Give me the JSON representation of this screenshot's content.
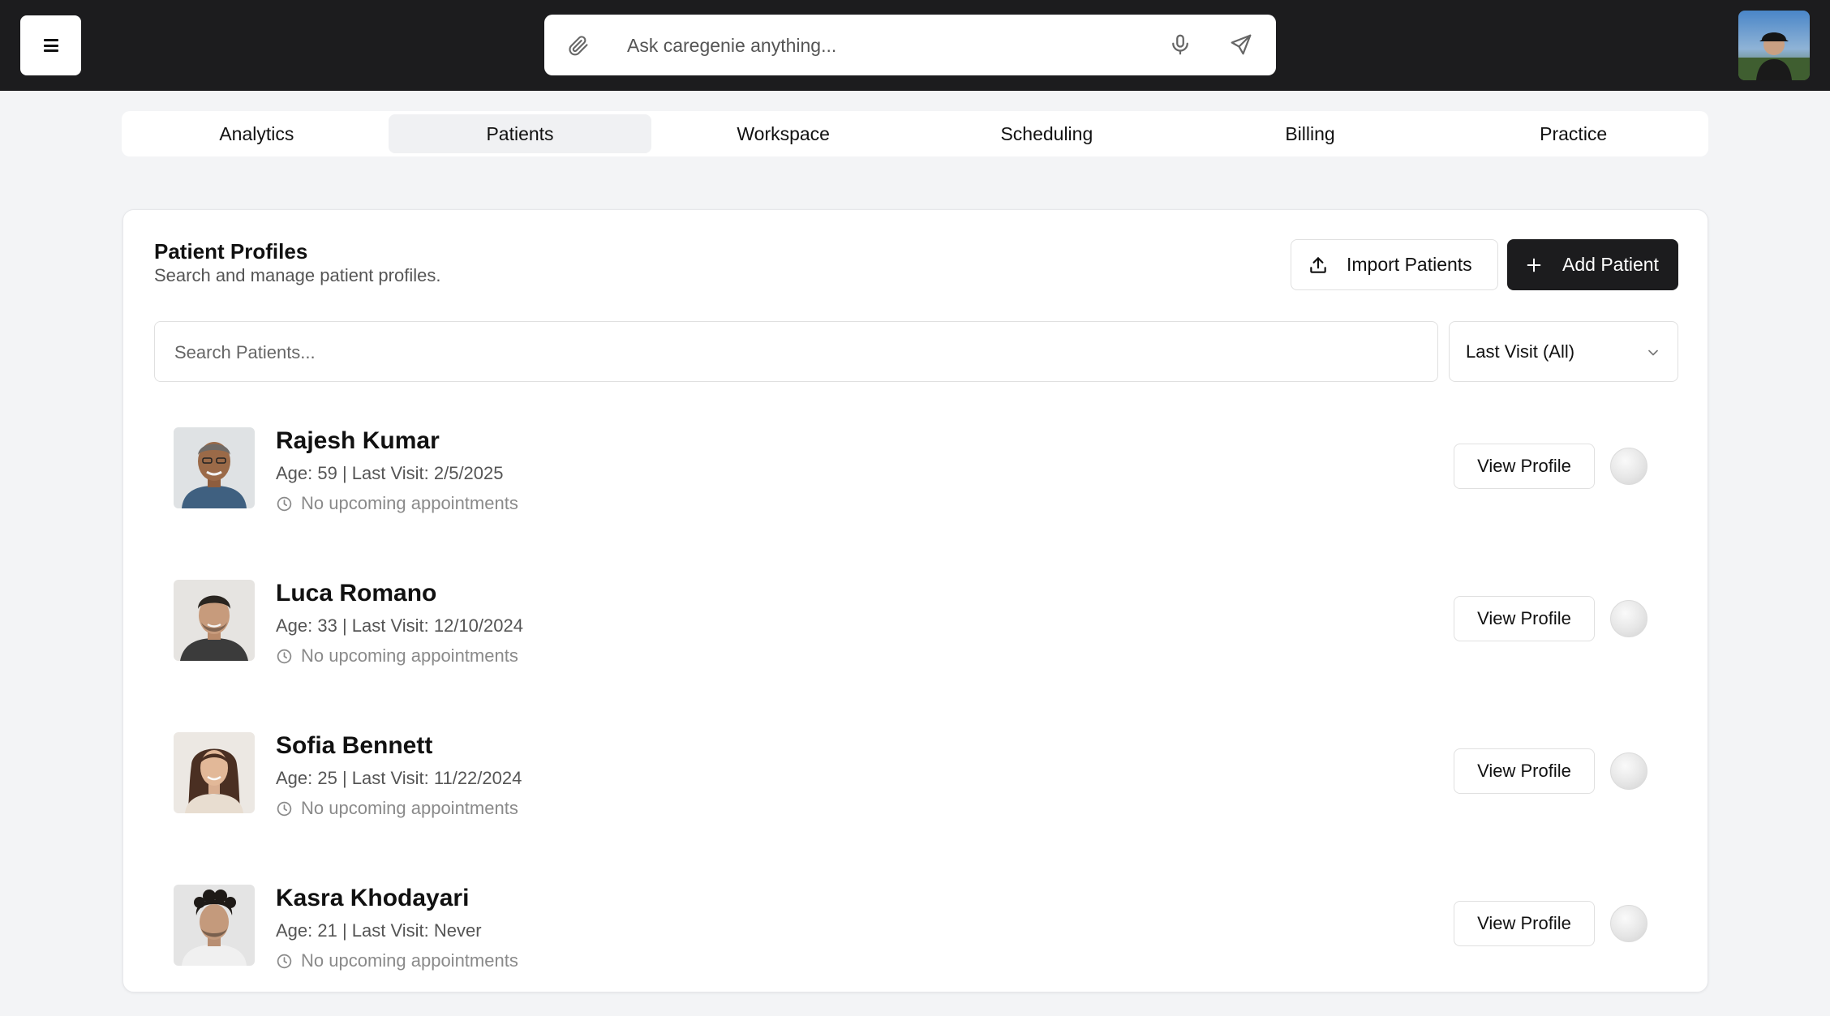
{
  "topbar": {
    "ask_placeholder": "Ask caregenie anything...",
    "icons": [
      "menu-icon",
      "paperclip-icon",
      "microphone-icon",
      "send-icon",
      "user-avatar"
    ]
  },
  "tabs": [
    {
      "label": "Analytics",
      "active": false
    },
    {
      "label": "Patients",
      "active": true
    },
    {
      "label": "Workspace",
      "active": false
    },
    {
      "label": "Scheduling",
      "active": false
    },
    {
      "label": "Billing",
      "active": false
    },
    {
      "label": "Practice",
      "active": false
    }
  ],
  "card": {
    "title": "Patient Profiles",
    "subtitle": "Search and manage patient profiles.",
    "import_label": "Import Patients",
    "add_label": "Add Patient",
    "search_placeholder": "Search Patients...",
    "filter_selected": "Last Visit (All)"
  },
  "patients": [
    {
      "name": "Rajesh Kumar",
      "meta": "Age: 59 | Last Visit: 2/5/2025",
      "appointments": "No upcoming appointments",
      "view_label": "View Profile"
    },
    {
      "name": "Luca Romano",
      "meta": "Age: 33 | Last Visit: 12/10/2024",
      "appointments": "No upcoming appointments",
      "view_label": "View Profile"
    },
    {
      "name": "Sofia Bennett",
      "meta": "Age: 25 | Last Visit: 11/22/2024",
      "appointments": "No upcoming appointments",
      "view_label": "View Profile"
    },
    {
      "name": "Kasra Khodayari",
      "meta": "Age: 21 | Last Visit: Never",
      "appointments": "No upcoming appointments",
      "view_label": "View Profile"
    }
  ],
  "colors": {
    "topbar": "#1c1c1e",
    "page_bg": "#f3f4f6",
    "primary_button": "#1c1c1e",
    "muted_text": "#8a8a8a"
  }
}
